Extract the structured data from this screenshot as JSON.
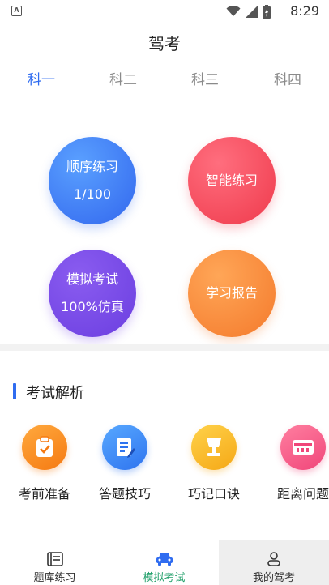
{
  "status_bar": {
    "time": "8:29",
    "notification_icon": "A"
  },
  "header": {
    "title": "驾考"
  },
  "tabs": [
    {
      "label": "科一",
      "active": true
    },
    {
      "label": "科二",
      "active": false
    },
    {
      "label": "科三",
      "active": false
    },
    {
      "label": "科四",
      "active": false
    }
  ],
  "practice": {
    "sequential": {
      "label": "顺序练习",
      "progress": "1/100"
    },
    "smart": {
      "label": "智能练习"
    },
    "mock": {
      "label": "模拟考试",
      "sub": "100%仿真"
    },
    "report": {
      "label": "学习报告"
    }
  },
  "analysis": {
    "title": "考试解析",
    "items": [
      {
        "label": "考前准备",
        "icon": "clipboard-icon",
        "color": "#f57a12"
      },
      {
        "label": "答题技巧",
        "icon": "edit-document-icon",
        "color": "#2f74ef"
      },
      {
        "label": "巧记口诀",
        "icon": "lamp-icon",
        "color": "#f5a816"
      },
      {
        "label": "距离问题",
        "icon": "ruler-icon",
        "color": "#f0467a"
      }
    ]
  },
  "bottom_nav": [
    {
      "label": "题库练习",
      "icon": "question-bank-icon",
      "active": false
    },
    {
      "label": "模拟考试",
      "icon": "car-icon",
      "active": true
    },
    {
      "label": "我的驾考",
      "icon": "user-icon",
      "active": false
    }
  ],
  "colors": {
    "accent": "#2f6cf0",
    "nav_active": "#22a06b"
  }
}
